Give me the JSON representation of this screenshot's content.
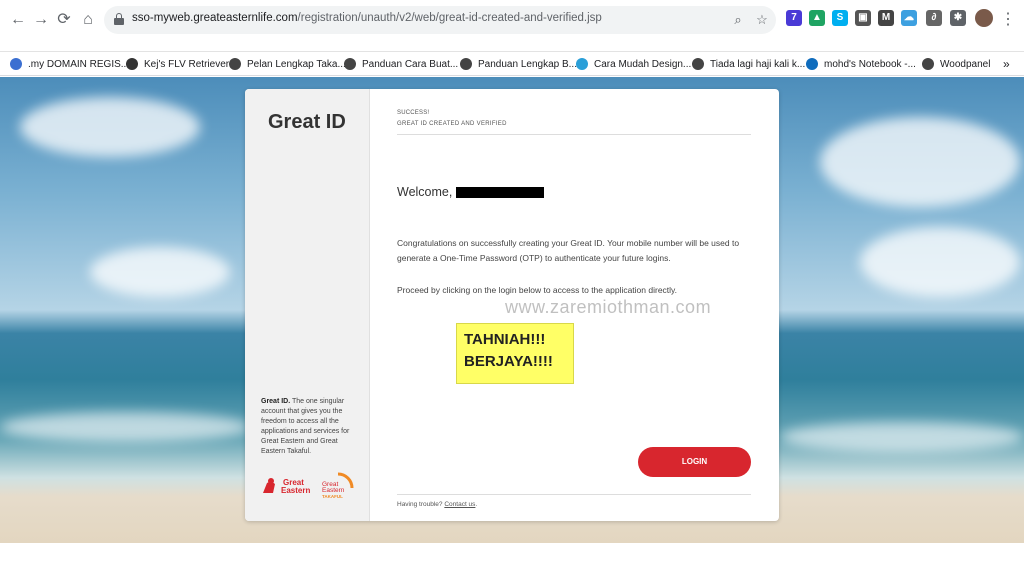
{
  "browser": {
    "url_host": "sso-myweb.greateasternlife.com",
    "url_path": "/registration/unauth/v2/web/great-id-created-and-verified.jsp",
    "nav": {
      "back": "←",
      "forward": "→",
      "reload": "⟳",
      "home": "⌂"
    },
    "omnibox_icons": {
      "zoom": "⌕",
      "star": "☆"
    },
    "extensions": [
      {
        "name": "extension-badge-icon",
        "label": "7",
        "color": "#4a3ad6"
      },
      {
        "name": "drive-icon",
        "label": "▲",
        "color": "#1fa463"
      },
      {
        "name": "skype-icon",
        "label": "S",
        "color": "#00aff0"
      },
      {
        "name": "screenshot-icon",
        "label": "▣",
        "color": "#555555"
      },
      {
        "name": "gmail-icon",
        "label": "M",
        "color": "#444444"
      },
      {
        "name": "cloud-icon",
        "label": "☁",
        "color": "#3da0e0"
      },
      {
        "name": "script-icon",
        "label": "∂",
        "color": "#666666"
      },
      {
        "name": "puzzle-icon",
        "label": "✱",
        "color": "#5f6368"
      }
    ],
    "menu": "⋮"
  },
  "bookmarks": [
    {
      "label": ".my DOMAIN REGIS...",
      "color": "#3b6fd1"
    },
    {
      "label": "Kej's FLV Retriever",
      "color": "#333333"
    },
    {
      "label": "Pelan Lengkap Taka...",
      "color": "#444444"
    },
    {
      "label": "Panduan Cara Buat...",
      "color": "#444444"
    },
    {
      "label": "Panduan Lengkap B...",
      "color": "#444444"
    },
    {
      "label": "Cara Mudah Design...",
      "color": "#2a9fd8"
    },
    {
      "label": "Tiada lagi haji kali k...",
      "color": "#444444"
    },
    {
      "label": "mohd's Notebook -...",
      "color": "#0f6cbd"
    },
    {
      "label": "Woodpanel",
      "color": "#444444"
    }
  ],
  "bookmarks_more": "»",
  "card": {
    "side_title": "Great ID",
    "side_desc_bold": "Great ID.",
    "side_desc": "The one singular account that gives you the freedom to access all the applications and services for Great Eastern and Great Eastern Takaful.",
    "logo_ge": "Great Eastern",
    "logo_takaful_top": "Great Eastern",
    "logo_takaful_bottom": "TAKAFUL",
    "success_top": "SUCCESS!",
    "success_sub": "GREAT ID CREATED AND VERIFIED",
    "welcome": "Welcome,",
    "congrats": "Congratulations on successfully creating your Great ID. Your mobile number will be used to generate a One-Time Password (OTP) to authenticate your future logins.",
    "proceed": "Proceed by clicking on the login below to access to the application directly.",
    "login_label": "LOGIN",
    "trouble_text": "Having trouble?",
    "contact_link": "Contact us",
    "trouble_end": "."
  },
  "overlay": {
    "watermark": "www.zaremiothman.com",
    "sticky_line1": "TAHNIAH!!!",
    "sticky_line2": "BERJAYA!!!!"
  },
  "colors": {
    "brand_red": "#d8262e",
    "sticky_yellow": "#ffff66"
  }
}
